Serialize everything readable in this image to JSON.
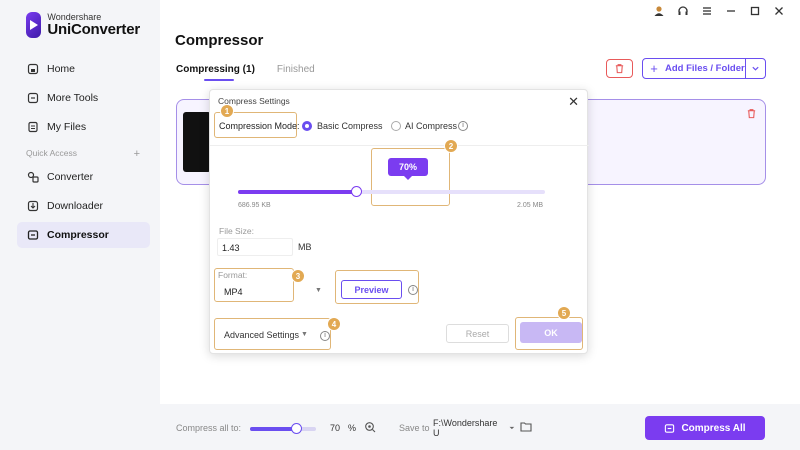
{
  "app": {
    "brand_small": "Wondershare",
    "brand_name": "UniConverter"
  },
  "sidebar": {
    "items": [
      {
        "label": "Home",
        "icon": "home-icon"
      },
      {
        "label": "More Tools",
        "icon": "tools-icon"
      },
      {
        "label": "My Files",
        "icon": "files-icon"
      }
    ],
    "quick_access_label": "Quick Access",
    "quick_access_add": "+",
    "quick_items": [
      {
        "label": "Converter",
        "icon": "converter-icon"
      },
      {
        "label": "Downloader",
        "icon": "downloader-icon"
      },
      {
        "label": "Compressor",
        "icon": "compressor-icon",
        "active": true
      }
    ]
  },
  "header": {
    "title": "Compressor",
    "tabs": [
      {
        "label": "Compressing (1)",
        "active": true
      },
      {
        "label": "Finished",
        "active": false
      }
    ],
    "add_files_label": "Add Files / Folder"
  },
  "dialog": {
    "title": "Compress Settings",
    "mode_label": "Compression Mode:",
    "modes": [
      "Basic Compress",
      "AI Compress"
    ],
    "selected_mode": "Basic Compress",
    "percent_label": "70%",
    "percent_value": 70,
    "min_size": "686.95 KB",
    "max_size": "2.05 MB",
    "file_size_label": "File Size:",
    "file_size_value": "1.43",
    "file_size_unit": "MB",
    "format_label": "Format:",
    "format_value": "MP4",
    "preview_label": "Preview",
    "advanced_label": "Advanced Settings",
    "reset_label": "Reset",
    "ok_label": "OK",
    "badges": [
      "1",
      "2",
      "3",
      "4",
      "5"
    ]
  },
  "bottom": {
    "compress_all_label": "Compress all to:",
    "compress_all_value": "70",
    "compress_all_unit": "%",
    "compress_all_percent": 70,
    "save_to_label": "Save to",
    "save_path": "F:\\Wondershare U",
    "compress_all_button": "Compress All"
  },
  "colors": {
    "accent": "#7b3cf0",
    "highlight": "#e0b677",
    "danger": "#e85a5a"
  }
}
